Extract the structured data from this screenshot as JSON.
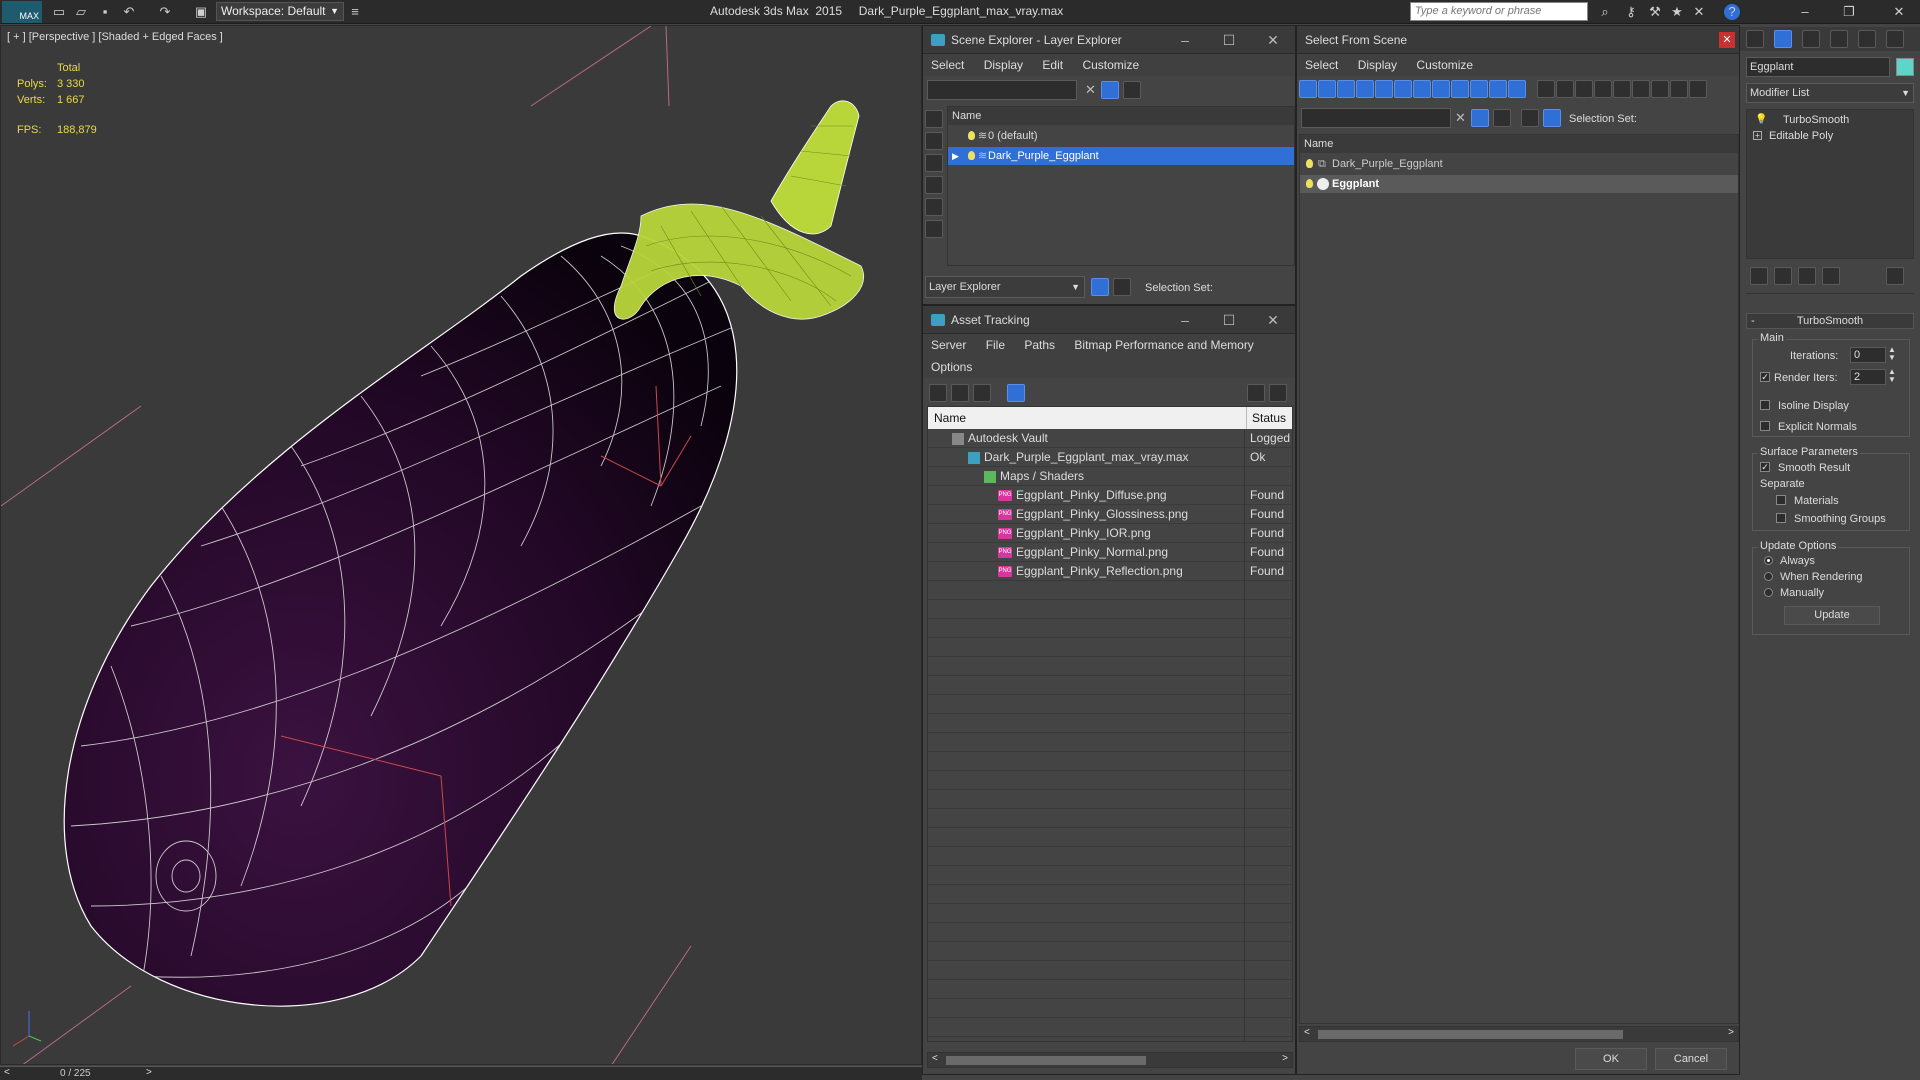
{
  "app": {
    "logo": "MAX",
    "workspace_label": "Workspace: Default",
    "title": "Autodesk 3ds Max  2015     Dark_Purple_Eggplant_max_vray.max",
    "search_placeholder": "Type a keyword or phrase"
  },
  "viewport": {
    "label": "[ + ] [Perspective ] [Shaded + Edged Faces ]",
    "stats_header": "Total",
    "polys_label": "Polys:",
    "polys_value": "3 330",
    "verts_label": "Verts:",
    "verts_value": "1 667",
    "fps_label": "FPS:",
    "fps_value": "188,879",
    "timeline": "0 / 225"
  },
  "scene_explorer": {
    "title": "Scene Explorer - Layer Explorer",
    "menu": [
      "Select",
      "Display",
      "Edit",
      "Customize"
    ],
    "col_name": "Name",
    "layers": [
      "0 (default)",
      "Dark_Purple_Eggplant"
    ],
    "footer_dropdown": "Layer Explorer",
    "selection_set": "Selection Set:"
  },
  "asset_tracking": {
    "title": "Asset Tracking",
    "menu": [
      "Server",
      "File",
      "Paths",
      "Bitmap Performance and Memory"
    ],
    "menu2": "Options",
    "col_name": "Name",
    "col_status": "Status",
    "rows": [
      {
        "name": "Autodesk Vault",
        "status": "Logged",
        "indent": 0
      },
      {
        "name": "Dark_Purple_Eggplant_max_vray.max",
        "status": "Ok",
        "indent": 1
      },
      {
        "name": "Maps / Shaders",
        "status": "",
        "indent": 2
      },
      {
        "name": "Eggplant_Pinky_Diffuse.png",
        "status": "Found",
        "indent": 3
      },
      {
        "name": "Eggplant_Pinky_Glossiness.png",
        "status": "Found",
        "indent": 3
      },
      {
        "name": "Eggplant_Pinky_IOR.png",
        "status": "Found",
        "indent": 3
      },
      {
        "name": "Eggplant_Pinky_Normal.png",
        "status": "Found",
        "indent": 3
      },
      {
        "name": "Eggplant_Pinky_Reflection.png",
        "status": "Found",
        "indent": 3
      }
    ]
  },
  "select_from_scene": {
    "title": "Select From Scene",
    "menu": [
      "Select",
      "Display",
      "Customize"
    ],
    "selection_set": "Selection Set:",
    "col_name": "Name",
    "items": [
      "Dark_Purple_Eggplant",
      "Eggplant"
    ],
    "ok": "OK",
    "cancel": "Cancel"
  },
  "command_panel": {
    "object_name": "Eggplant",
    "modifier_list": "Modifier List",
    "stack": [
      "TurboSmooth",
      "Editable Poly"
    ],
    "rollout_title": "TurboSmooth",
    "main_group": "Main",
    "iterations_label": "Iterations:",
    "iterations_value": "0",
    "render_iters_label": "Render Iters:",
    "render_iters_value": "2",
    "isoline_label": "Isoline Display",
    "explicit_normals_label": "Explicit Normals",
    "surface_group": "Surface Parameters",
    "smooth_result_label": "Smooth Result",
    "separate_label": "Separate",
    "materials_label": "Materials",
    "smoothing_groups_label": "Smoothing Groups",
    "update_group": "Update Options",
    "always_label": "Always",
    "when_rendering_label": "When Rendering",
    "manually_label": "Manually",
    "update_button": "Update"
  },
  "colors": {
    "selection_blue": "#2f6fd6",
    "eggplant": "#2a0a2c",
    "stem": "#b8d63a"
  }
}
